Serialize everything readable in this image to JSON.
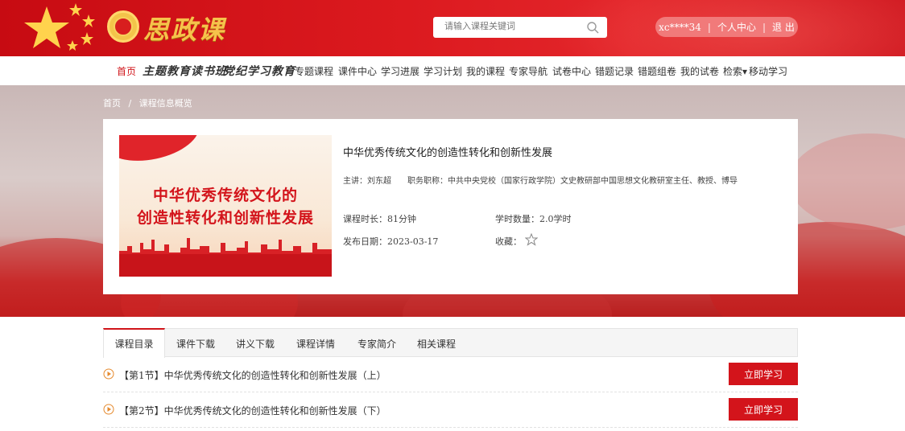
{
  "header": {
    "brand": "思政课",
    "search_placeholder": "请输入课程关键词",
    "user_name": "xc****34",
    "separator": "|",
    "profile_label": "个人中心",
    "logout_label": "退 出"
  },
  "nav": {
    "items": [
      {
        "label": "首页"
      },
      {
        "label": "主题教育读书班"
      },
      {
        "label": "党纪学习教育"
      },
      {
        "label": "专题课程"
      },
      {
        "label": "课件中心"
      },
      {
        "label": "学习进展"
      },
      {
        "label": "学习计划"
      },
      {
        "label": "我的课程"
      },
      {
        "label": "专家导航"
      },
      {
        "label": "试卷中心"
      },
      {
        "label": "错题记录"
      },
      {
        "label": "错题组卷"
      },
      {
        "label": "我的试卷"
      },
      {
        "label": "检索▾"
      },
      {
        "label": "移动学习"
      }
    ]
  },
  "breadcrumb": {
    "home": "首页",
    "sep": "/",
    "current": "课程信息概览"
  },
  "course": {
    "title": "中华优秀传统文化的创造性转化和创新性发展",
    "image_line1": "中华优秀传统文化的",
    "image_line2": "创造性转化和创新性发展",
    "teacher": "主讲：刘东超　　职务职称：中共中央党校（国家行政学院）文史教研部中国思想文化教研室主任、教授、博导",
    "duration": "课程时长：81分钟",
    "hours": "学时数量：2.0学时",
    "publish_date": "发布日期：2023-03-17",
    "favorite_label": "收藏："
  },
  "tabs": [
    {
      "label": "课程目录"
    },
    {
      "label": "课件下载"
    },
    {
      "label": "讲义下载"
    },
    {
      "label": "课程详情"
    },
    {
      "label": "专家简介"
    },
    {
      "label": "相关课程"
    }
  ],
  "chapters": [
    {
      "label": "【第1节】中华优秀传统文化的创造性转化和创新性发展（上）",
      "button": "立即学习"
    },
    {
      "label": "【第2节】中华优秀传统文化的创造性转化和创新性发展（下）",
      "button": "立即学习"
    }
  ],
  "colors": {
    "primary_red": "#d3141b",
    "gold": "#f6c24b"
  }
}
